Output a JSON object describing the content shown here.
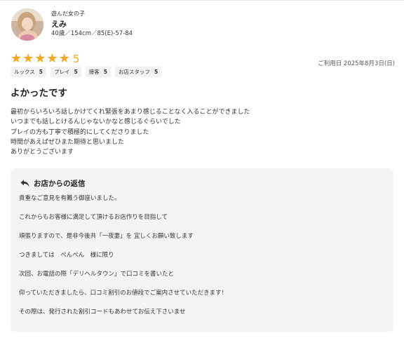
{
  "colors": {
    "star": "#f5a623",
    "reply_bg": "#f4f4f4",
    "chip_bg": "#f2f2f2"
  },
  "girl": {
    "caption": "遊んだ女の子",
    "name": "えみ",
    "spec": "40歳／154cm／85(E)-57-84"
  },
  "rating": {
    "stars": 5,
    "score": "5",
    "date": "ご利用日 2025年8月3日(日)",
    "categories": [
      {
        "label": "ルックス",
        "value": "5"
      },
      {
        "label": "プレイ",
        "value": "5"
      },
      {
        "label": "接客",
        "value": "5"
      },
      {
        "label": "お店スタッフ",
        "value": "5"
      }
    ]
  },
  "review": {
    "title": "よかったです",
    "lines": [
      "最初からいろいろ話しかけてくれ緊張をあまり感じることなく入ることができました",
      "いつまでも話しとけるんじゃないかなと感じるぐらいでした",
      "プレイの方も丁寧で積極的にしてくださりました",
      "時間があえばぜひまた期待と思いました",
      "ありがとうございます"
    ]
  },
  "reply": {
    "icon": "reply-arrow-icon",
    "title": "お店からの返信",
    "lines": [
      "貴重なご意見を有難う御座いました。",
      "これからもお客様に満足して頂けるお店作りを目指して",
      "頑張りますので、是非今後共「一夜妻」を 宜しくお願い致します",
      "つきましては　ぺんぺん　様に限り",
      "次回、お電話の際「デリヘルタウン」で口コミを書いたと",
      "仰っていただきましたら、口コミ割引のお値段でご案内させていただきます！",
      "その際は、発行された割引コードもあわせてお伝え下さいませ"
    ]
  }
}
